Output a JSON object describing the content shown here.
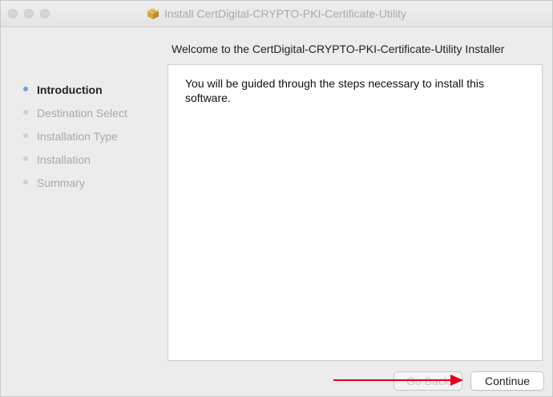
{
  "window": {
    "title": "Install CertDigital-CRYPTO-PKI-Certificate-Utility",
    "title_icon": "package-icon"
  },
  "header": {
    "text": "Welcome to the CertDigital-CRYPTO-PKI-Certificate-Utility Installer"
  },
  "sidebar": {
    "steps": [
      {
        "label": "Introduction",
        "active": true
      },
      {
        "label": "Destination Select",
        "active": false
      },
      {
        "label": "Installation Type",
        "active": false
      },
      {
        "label": "Installation",
        "active": false
      },
      {
        "label": "Summary",
        "active": false
      }
    ]
  },
  "content": {
    "body": "You will be guided through the steps necessary to install this software."
  },
  "buttons": {
    "back": "Go Back",
    "continue": "Continue"
  },
  "colors": {
    "active_bullet": "#6aa3e0",
    "annotation_arrow": "#e3001b"
  }
}
